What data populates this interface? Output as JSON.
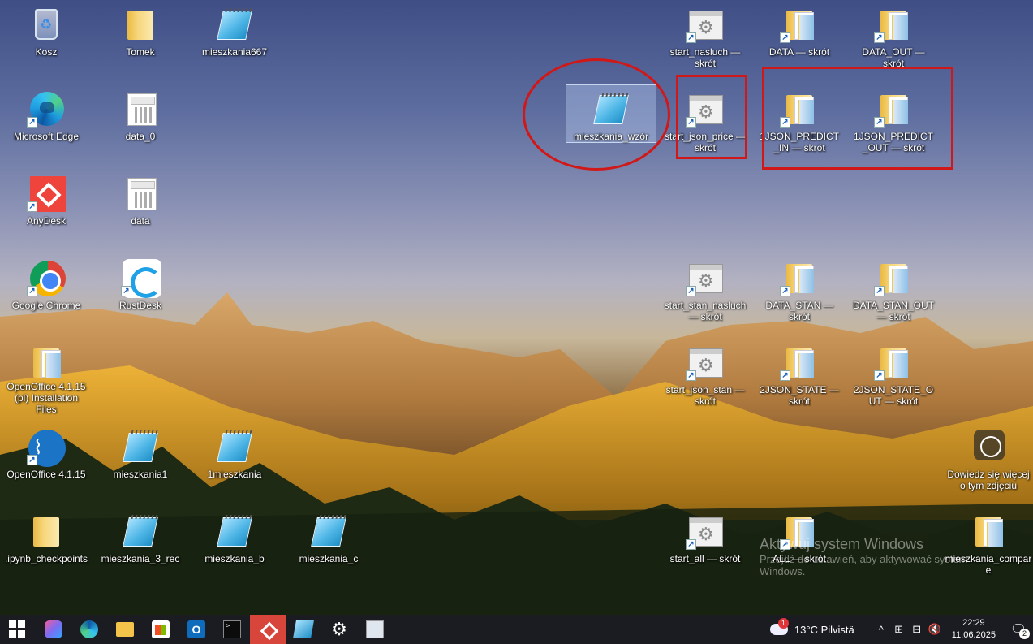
{
  "desktop": {
    "icons": [
      {
        "label": "Kosz",
        "glyph": "recycle-bin-icon"
      },
      {
        "label": "Tomek",
        "glyph": "folder-icon"
      },
      {
        "label": "mieszkania667",
        "glyph": "notepad-icon"
      },
      {
        "label": "Microsoft Edge",
        "glyph": "edge-icon"
      },
      {
        "label": "data_0",
        "glyph": "spreadsheet-icon"
      },
      {
        "label": "AnyDesk",
        "glyph": "anydesk-icon"
      },
      {
        "label": "data",
        "glyph": "spreadsheet-icon"
      },
      {
        "label": "Google Chrome",
        "glyph": "chrome-icon"
      },
      {
        "label": "RustDesk",
        "glyph": "rustdesk-icon"
      },
      {
        "label": "OpenOffice 4.1.15 (pl) Installation Files",
        "glyph": "folder-icon"
      },
      {
        "label": "OpenOffice 4.1.15",
        "glyph": "openoffice-icon"
      },
      {
        "label": "mieszkania1",
        "glyph": "notepad-icon"
      },
      {
        "label": "1mieszkania",
        "glyph": "notepad-icon"
      },
      {
        "label": ".ipynb_checkpoints",
        "glyph": "folder-icon"
      },
      {
        "label": "mieszkania_3_rec",
        "glyph": "notepad-icon"
      },
      {
        "label": "mieszkania_b",
        "glyph": "notepad-icon"
      },
      {
        "label": "mieszkania_c",
        "glyph": "notepad-icon"
      },
      {
        "label": "mieszkania_wzór",
        "glyph": "notepad-icon"
      },
      {
        "label": "start_nasluch — skrót",
        "glyph": "settings-file-icon"
      },
      {
        "label": "DATA — skrót",
        "glyph": "folder-icon"
      },
      {
        "label": "DATA_OUT — skrót",
        "glyph": "folder-icon"
      },
      {
        "label": "start_json_price — skrót",
        "glyph": "settings-file-icon"
      },
      {
        "label": "1JSON_PREDICT_IN — skrót",
        "glyph": "folder-icon"
      },
      {
        "label": "1JSON_PREDICT_OUT — skrót",
        "glyph": "folder-icon"
      },
      {
        "label": "start_stan_nasluch — skrót",
        "glyph": "settings-file-icon"
      },
      {
        "label": "DATA_STAN — skrót",
        "glyph": "folder-icon"
      },
      {
        "label": "DATA_STAN_OUT — skrót",
        "glyph": "folder-icon"
      },
      {
        "label": "start_json_stan — skrót",
        "glyph": "settings-file-icon"
      },
      {
        "label": "2JSON_STATE — skrót",
        "glyph": "folder-icon"
      },
      {
        "label": "2JSON_STATE_OUT — skrót",
        "glyph": "folder-icon"
      },
      {
        "label": "Dowiedz się więcej o tym zdjęciu",
        "glyph": "info-icon"
      },
      {
        "label": "start_all — skrót",
        "glyph": "settings-file-icon"
      },
      {
        "label": "ALL — skrót",
        "glyph": "folder-icon"
      },
      {
        "label": "mieszkania_compare",
        "glyph": "folder-icon"
      }
    ],
    "selected_icon": "mieszkania_wzór",
    "annotation_color": "#d01818",
    "watermark": {
      "title": "Aktywuj system Windows",
      "subtitle": "Przejdź do ustawień, aby aktywować system Windows."
    }
  },
  "taskbar": {
    "apps": [
      "start-icon",
      "copilot-icon",
      "edge-icon",
      "file-explorer-icon",
      "store-icon",
      "outlook-icon",
      "terminal-icon",
      "anydesk-icon",
      "notepad-icon",
      "settings-icon",
      "remote-desktop-icon"
    ],
    "active_app": "anydesk-icon",
    "cmd_glyph": ">_",
    "outlook_glyph": "O",
    "weather": {
      "badge": "1",
      "temp": "13°C",
      "condition": "Pilvistä"
    },
    "tray": {
      "chevron": "^",
      "lang": "⊞",
      "network": "⊟",
      "volume": "🔇"
    },
    "clock": {
      "time": "22:29",
      "date": "11.06.2025"
    },
    "notifications": {
      "count": "2"
    },
    "accent": "#d8453a",
    "background": "#1b1c22"
  }
}
